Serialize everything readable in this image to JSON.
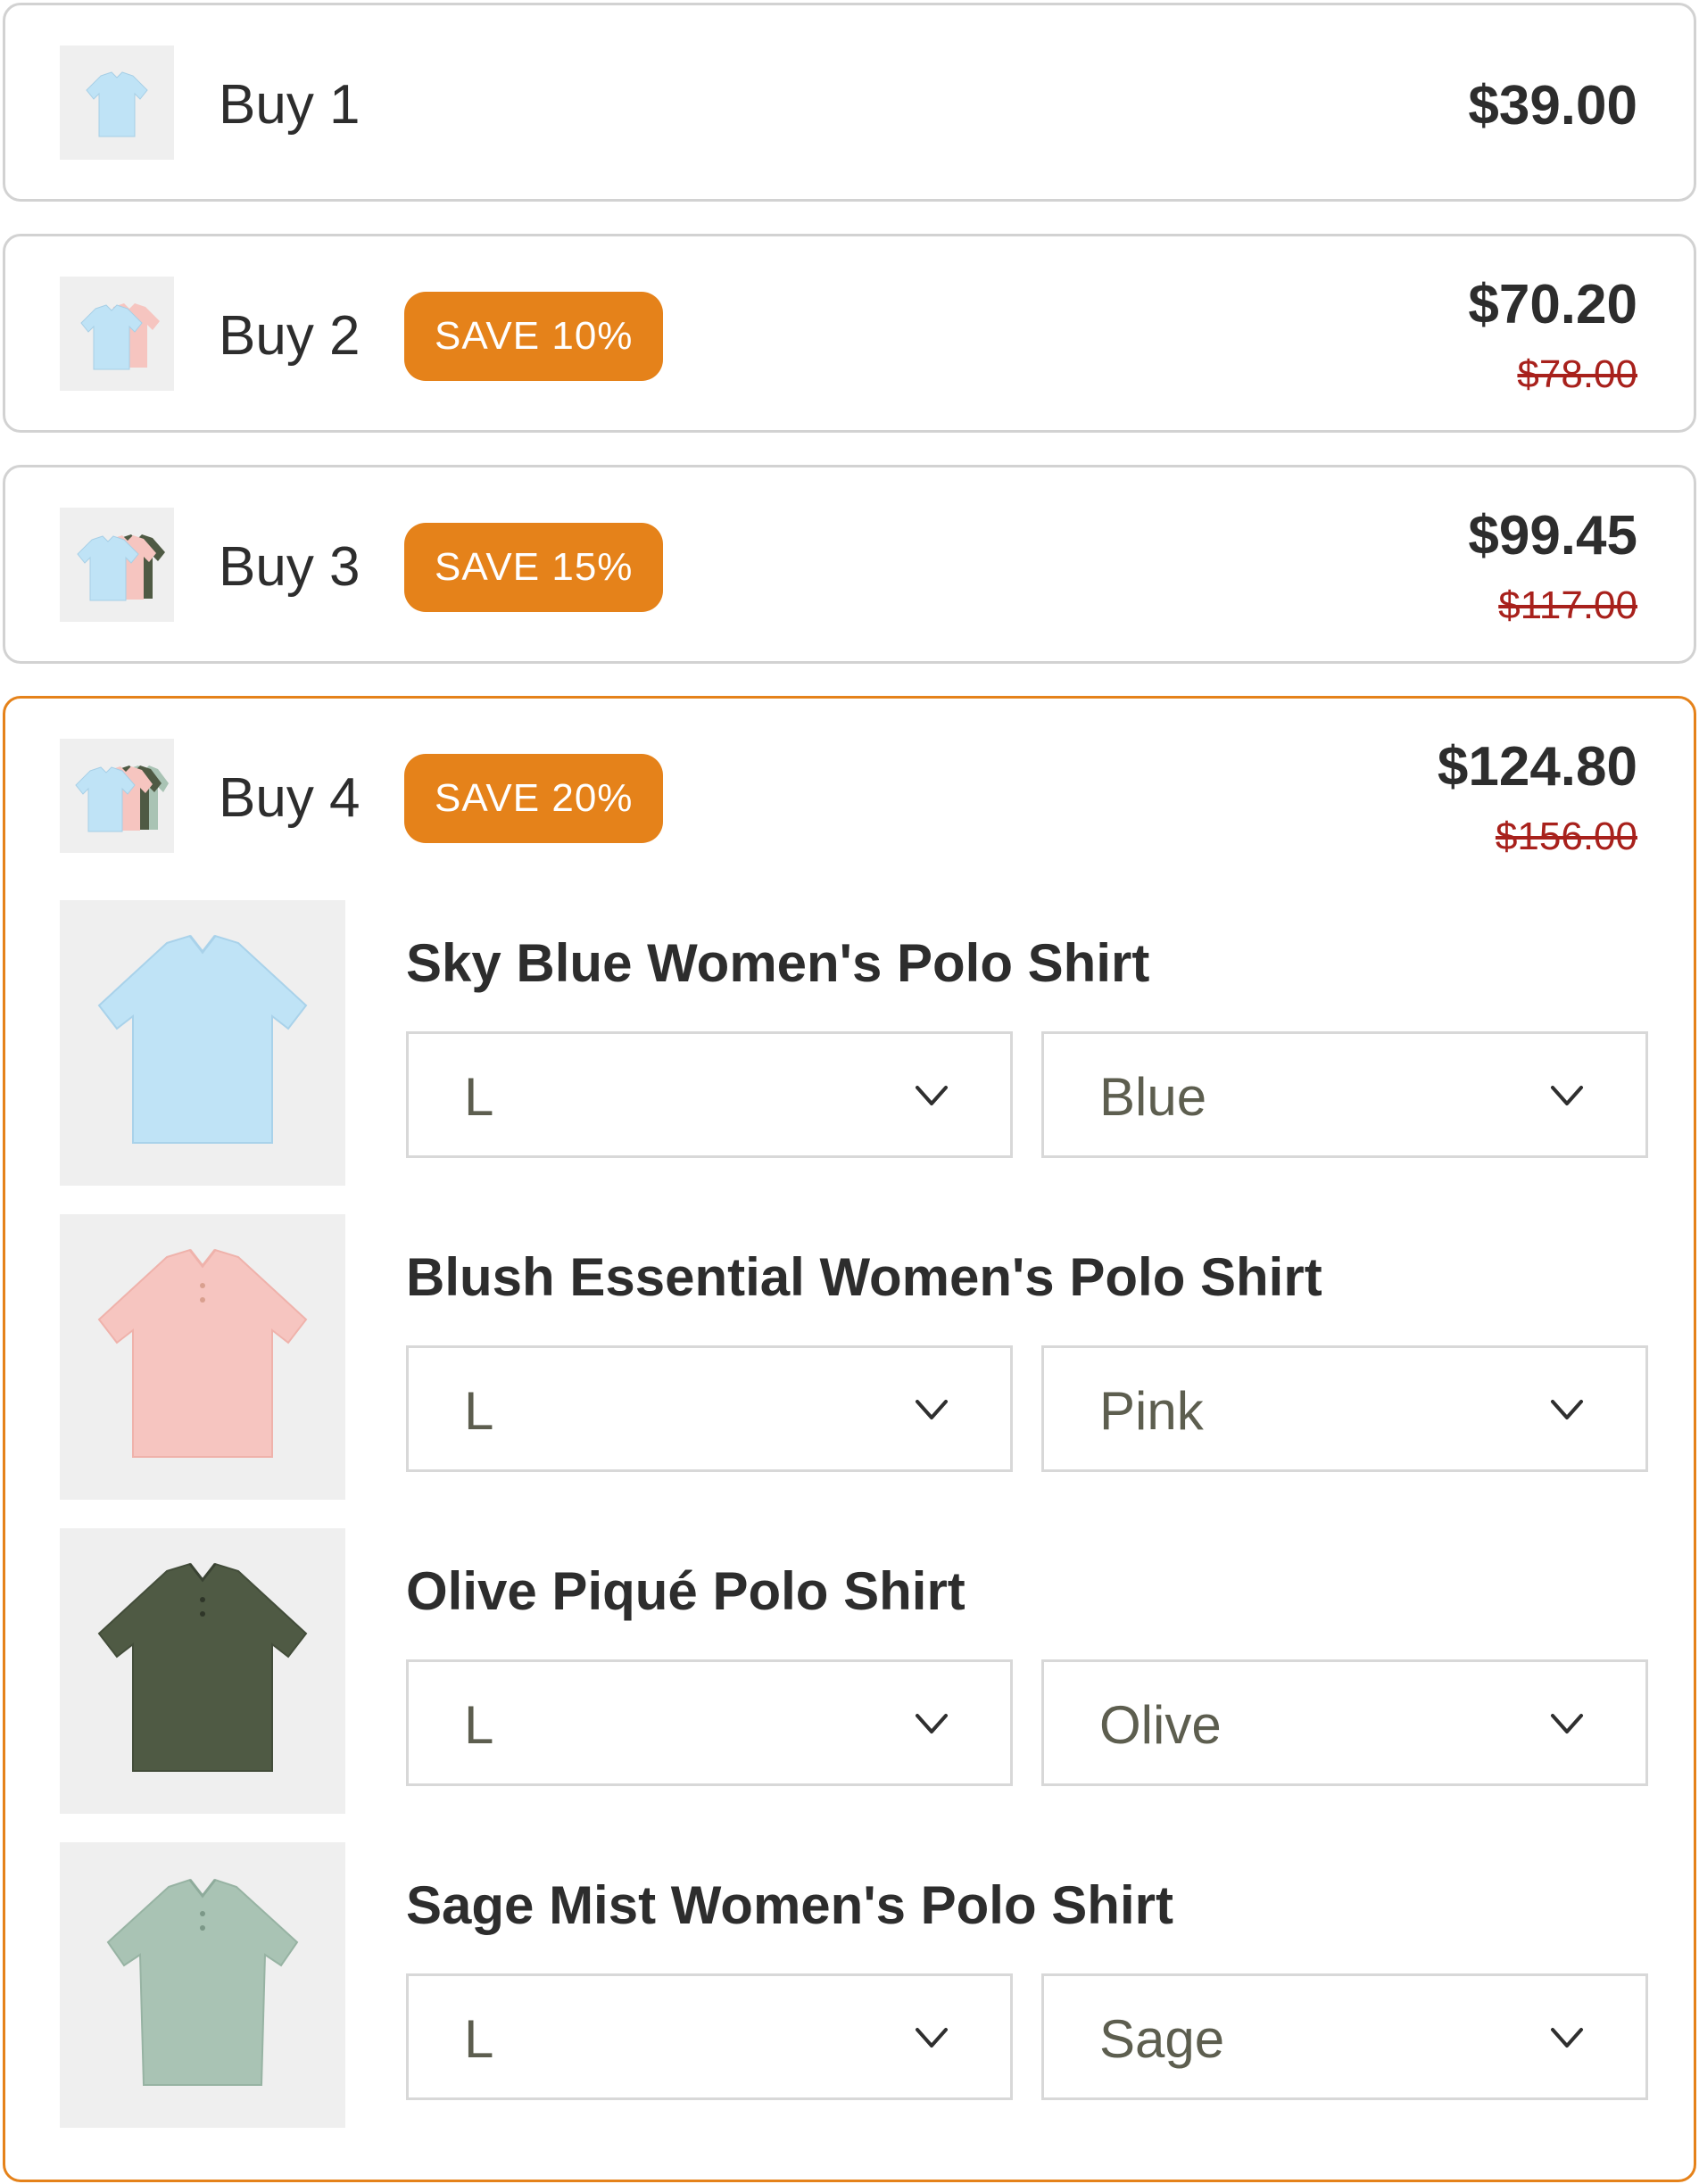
{
  "offers": [
    {
      "label": "Buy 1",
      "badge": "",
      "price": "$39.00",
      "old_price": ""
    },
    {
      "label": "Buy 2",
      "badge": "SAVE 10%",
      "price": "$70.20",
      "old_price": "$78.00"
    },
    {
      "label": "Buy 3",
      "badge": "SAVE 15%",
      "price": "$99.45",
      "old_price": "$117.00"
    },
    {
      "label": "Buy 4",
      "badge": "SAVE 20%",
      "price": "$124.80",
      "old_price": "$156.00"
    }
  ],
  "items": [
    {
      "title": "Sky Blue Women's Polo Shirt",
      "size": "L",
      "color": "Blue",
      "swatch": "#bfe3f6"
    },
    {
      "title": "Blush Essential Women's Polo Shirt",
      "size": "L",
      "color": "Pink",
      "swatch": "#f6c5c0"
    },
    {
      "title": "Olive Piqué Polo Shirt",
      "size": "L",
      "color": "Olive",
      "swatch": "#4f5a44"
    },
    {
      "title": "Sage Mist Women's Polo Shirt",
      "size": "L",
      "color": "Sage",
      "swatch": "#a9c3b4"
    }
  ],
  "colors": {
    "accent": "#e5821a",
    "strike_price": "#a8211c",
    "border": "#d2d2d2"
  },
  "icons": {
    "dropdown": "chevron-down-icon",
    "thumbnail": "polo-shirt-icon"
  }
}
